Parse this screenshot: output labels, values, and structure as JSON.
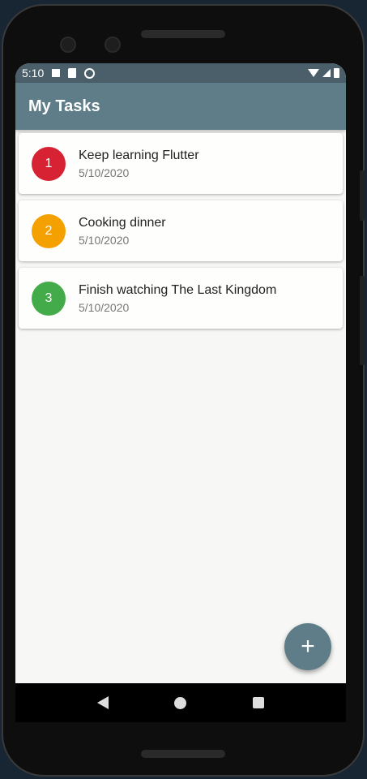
{
  "status": {
    "time": "5:10"
  },
  "appbar": {
    "title": "My Tasks"
  },
  "tasks": [
    {
      "number": "1",
      "title": "Keep learning Flutter",
      "date": "5/10/2020",
      "color": "#d62233"
    },
    {
      "number": "2",
      "title": "Cooking dinner",
      "date": "5/10/2020",
      "color": "#f4a100"
    },
    {
      "number": "3",
      "title": "Finish watching The Last Kingdom",
      "date": "5/10/2020",
      "color": "#43ab49"
    }
  ],
  "fab": {
    "label": "+"
  }
}
